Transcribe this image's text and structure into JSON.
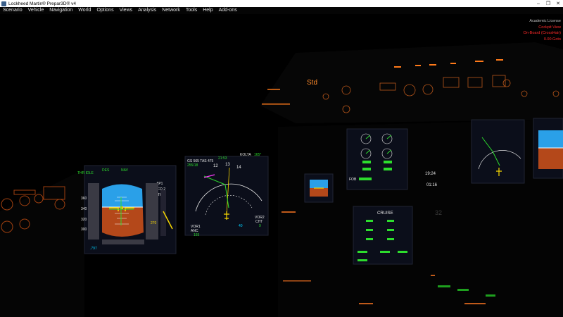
{
  "window": {
    "title": "Lockheed Martin® Prepar3D® v4"
  },
  "menu": [
    "Scenario",
    "Vehicle",
    "Navigation",
    "World",
    "Options",
    "Views",
    "Analysis",
    "Network",
    "Tools",
    "Help",
    "Add-ons"
  ],
  "overlay": {
    "license": "Academic License",
    "cockpit": "Cockpit View",
    "onboard": "On-Board (CrossHair)",
    "fps": "0.00 Goto"
  },
  "cockpit": {
    "ecam_std": "Std",
    "fma": {
      "thr": "THR IDLE",
      "mode": "DES",
      "nav": "NAV",
      "ap1": "AP1",
      "fd": "1 FD 2",
      "athr": "A/THR"
    },
    "pfd": {
      "speed_top": "360",
      "speed_mid": "340",
      "speed_low": "320",
      "speed_bot": "300",
      "alt": "270",
      "baro": ".797"
    },
    "nd": {
      "gs_tas": "GS 565 TAS 475",
      "wind": "255/18",
      "waypoint": "KOLTA",
      "brg": "165°",
      "time": "21:53",
      "h1": "12",
      "h2": "13",
      "h3": "14",
      "vor1": "VOR1",
      "vor1_id": "ANC",
      "vor1_dist": "165",
      "vor2": "VOR2",
      "vor2_id": "CHT",
      "vor2_dist": "9",
      "range": "40"
    },
    "sd": {
      "title": "CRUISE",
      "fob": "FOB",
      "clock": "19:24",
      "clock2": "01:16"
    },
    "rpfd": {
      "alt": "32"
    }
  }
}
